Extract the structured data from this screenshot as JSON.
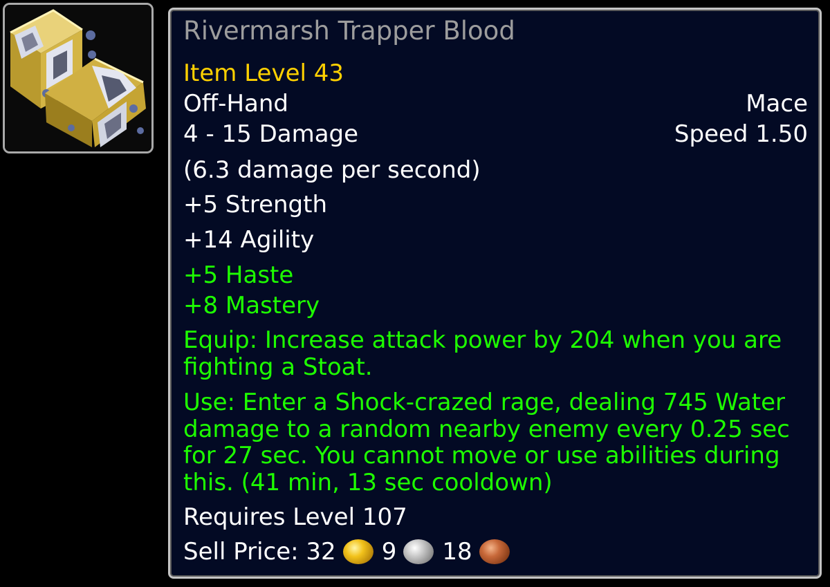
{
  "item": {
    "name": "Rivermarsh Trapper Blood",
    "item_level": "Item Level 43",
    "slot": "Off-Hand",
    "type": "Mace",
    "damage": "4 - 15 Damage",
    "speed": "Speed 1.50",
    "dps": "(6.3 damage per second)",
    "stats": [
      "+5 Strength",
      "+14 Agility"
    ],
    "secondary_stats": [
      "+5 Haste",
      "+8 Mastery"
    ],
    "equip_effect": "Equip: Increase attack power by 204 when you are fighting a Stoat.",
    "use_effect": "Use: Enter a Shock-crazed rage, dealing 745 Water damage to a random nearby enemy every 0.25 sec for 27 sec. You cannot move or use abilities during this. (41 min, 13 sec cooldown)",
    "requirement": "Requires Level 107",
    "sell_price_label": "Sell Price:",
    "sell_price_gold": "32",
    "sell_price_silver": "9",
    "sell_price_copper": "18",
    "icon": "mace-icon"
  },
  "colors": {
    "name": "#9d9d9d",
    "item_level": "#ffd100",
    "white_text": "#ffffff",
    "green_text": "#1eff00",
    "tooltip_bg": "#030a24",
    "border": "#c4c4c4"
  }
}
